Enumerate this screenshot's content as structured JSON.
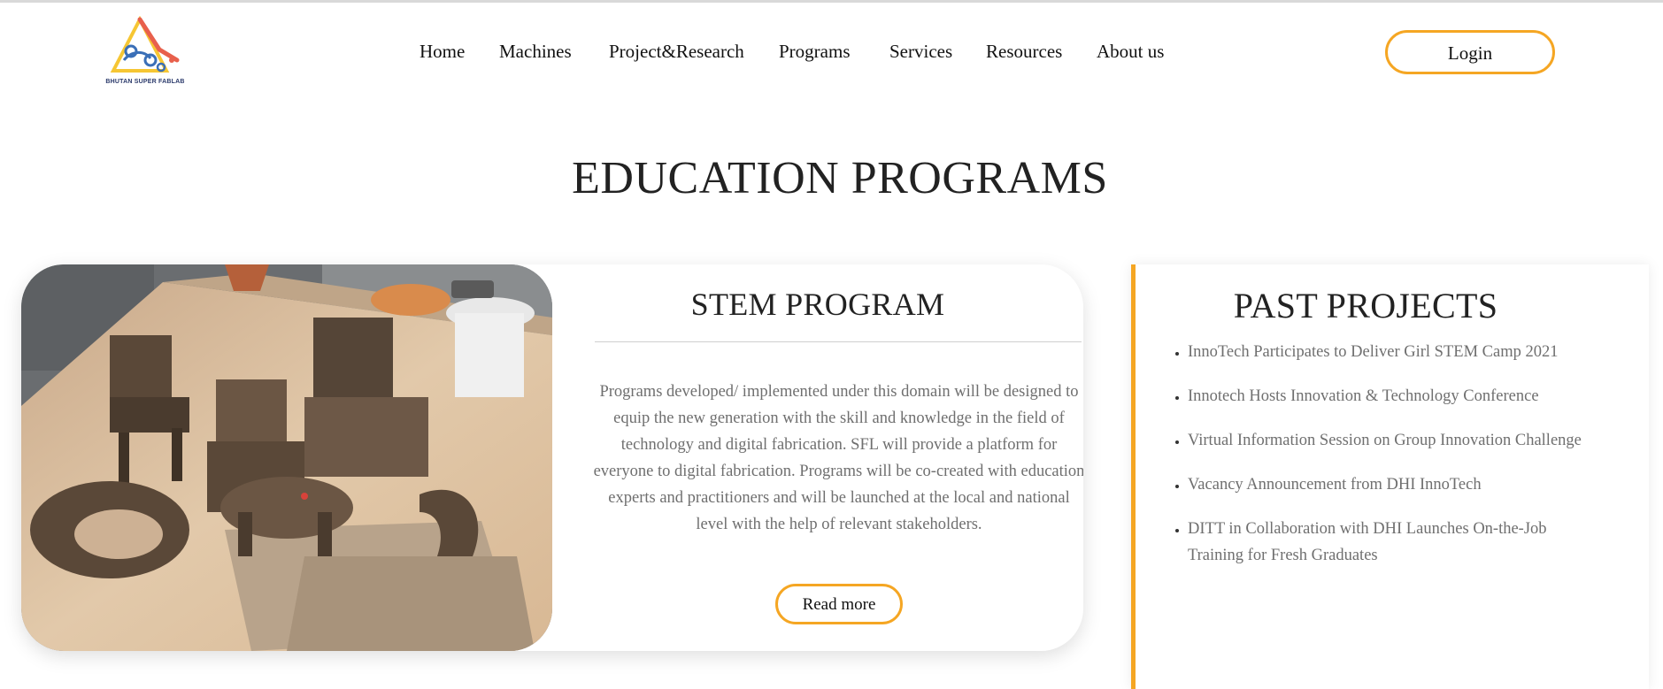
{
  "header": {
    "logo_text": "BHUTAN SUPER FABLAB",
    "nav": [
      "Home",
      "Machines",
      "Project&Research",
      "Programs",
      "Services",
      "Resources",
      "About us"
    ],
    "login_label": "Login"
  },
  "page_title": "EDUCATION PROGRAMS",
  "stem": {
    "title": "STEM PROGRAM",
    "description": "Programs developed/ implemented under this domain will be designed to equip the new generation with the skill and knowledge in the field of technology and digital fabrication. SFL will provide a platform for everyone to digital fabrication. Programs will be co-created with education experts and practitioners and will be launched at the local and national level with the help of relevant stakeholders.",
    "read_more_label": "Read more"
  },
  "past_projects": {
    "title": "PAST PROJECTS",
    "items": [
      "InnoTech Participates to Deliver Girl STEM Camp 2021",
      "Innotech Hosts Innovation & Technology Conference",
      "Virtual Information Session on Group Innovation Challenge",
      "Vacancy Announcement from DHI InnoTech",
      "DITT in Collaboration with DHI Launches On-the-Job Training for Fresh Graduates"
    ]
  },
  "colors": {
    "accent": "#f5a623",
    "text_muted": "#6f6f6f",
    "heading": "#222222"
  }
}
